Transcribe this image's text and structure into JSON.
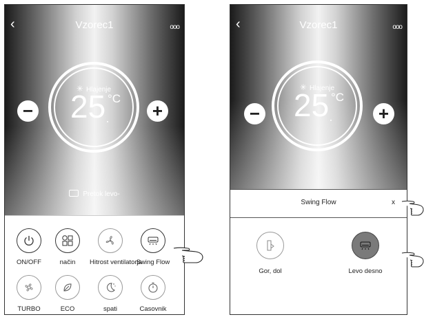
{
  "screen_left": {
    "header": {
      "back_icon": "chevron-left-icon",
      "title": "Vzorec1",
      "more_label": "ooo"
    },
    "thermostat": {
      "mode_icon": "snowflake-icon",
      "mode": "Hlajenje",
      "temperature": "25",
      "unit": "°C",
      "minus": "−",
      "plus": "+"
    },
    "flow_status": "Pretok levo-",
    "buttons_row1": [
      {
        "label": "ON/OFF",
        "icon": "power-icon"
      },
      {
        "label": "način",
        "icon": "mode-grid-icon"
      },
      {
        "label": "Hitrost ventilatorja",
        "icon": "fan-icon"
      },
      {
        "label": "Swing Flow",
        "icon": "swing-icon"
      }
    ],
    "buttons_row2": [
      {
        "label": "TURBO",
        "icon": "turbo-icon"
      },
      {
        "label": "ECO",
        "icon": "leaf-icon"
      },
      {
        "label": "spati",
        "icon": "sleep-moon-icon"
      },
      {
        "label": "Casovnik",
        "icon": "timer-icon"
      }
    ]
  },
  "screen_right": {
    "header": {
      "back_icon": "chevron-left-icon",
      "title": "Vzorec1",
      "more_label": "ooo"
    },
    "thermostat": {
      "mode_icon": "snowflake-icon",
      "mode": "Hlajenje",
      "temperature": "25",
      "unit": "°C",
      "minus": "−",
      "plus": "+"
    },
    "swing_dialog": {
      "title": "Swing Flow",
      "close": "x",
      "options": [
        {
          "label": "Gor, dol",
          "icon": "vertical-swing-icon",
          "selected": false
        },
        {
          "label": "Levo desno",
          "icon": "horizontal-swing-icon",
          "selected": true
        }
      ]
    }
  },
  "colors": {
    "selected_fill": "#7a7a7a",
    "icon_stroke": "#333333",
    "text_white": "#ffffff"
  }
}
